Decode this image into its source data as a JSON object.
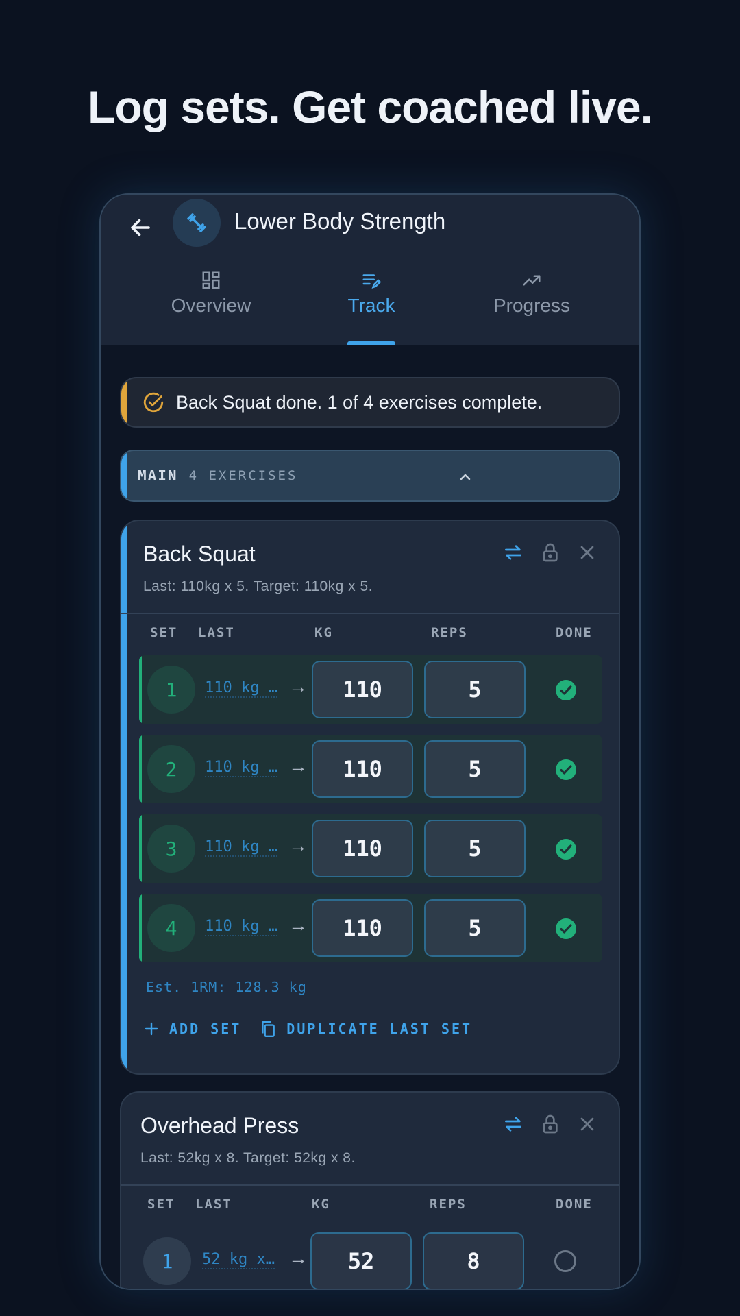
{
  "headline": "Log sets. Get coached live.",
  "app": {
    "title": "Lower Body Strength",
    "avatar_icon": "dumbbell-icon",
    "accent": "#3fa3ea"
  },
  "tabs": [
    {
      "label": "Overview",
      "icon": "dashboard-icon",
      "active": false
    },
    {
      "label": "Track",
      "icon": "edit-list-icon",
      "active": true
    },
    {
      "label": "Progress",
      "icon": "trending-up-icon",
      "active": false
    }
  ],
  "toast": {
    "text": "Back Squat done. 1 of 4 exercises complete.",
    "icon": "check-circle-icon",
    "accent": "#e0a53b"
  },
  "section": {
    "name": "MAIN",
    "count": "4 EXERCISES"
  },
  "columns": {
    "set": "SET",
    "last": "LAST",
    "kg": "KG",
    "reps": "REPS",
    "done": "DONE"
  },
  "exercises": [
    {
      "name": "Back Squat",
      "sub": "Last: 110kg x 5. Target: 110kg x 5.",
      "sets": [
        {
          "set": "1",
          "last": "110 kg …",
          "kg": "110",
          "reps": "5",
          "done": true
        },
        {
          "set": "2",
          "last": "110 kg …",
          "kg": "110",
          "reps": "5",
          "done": true
        },
        {
          "set": "3",
          "last": "110 kg …",
          "kg": "110",
          "reps": "5",
          "done": true
        },
        {
          "set": "4",
          "last": "110 kg …",
          "kg": "110",
          "reps": "5",
          "done": true
        }
      ],
      "est": "Est. 1RM: 128.3 kg",
      "add_set": "ADD SET",
      "duplicate": "DUPLICATE LAST SET"
    },
    {
      "name": "Overhead Press",
      "sub": "Last: 52kg x 8. Target: 52kg x 8.",
      "sets": [
        {
          "set": "1",
          "last": "52 kg x…",
          "kg": "52",
          "reps": "8",
          "done": false
        }
      ]
    }
  ],
  "arrow": "→",
  "colors": {
    "done_green": "#22b07a",
    "background": "#0b1220"
  }
}
